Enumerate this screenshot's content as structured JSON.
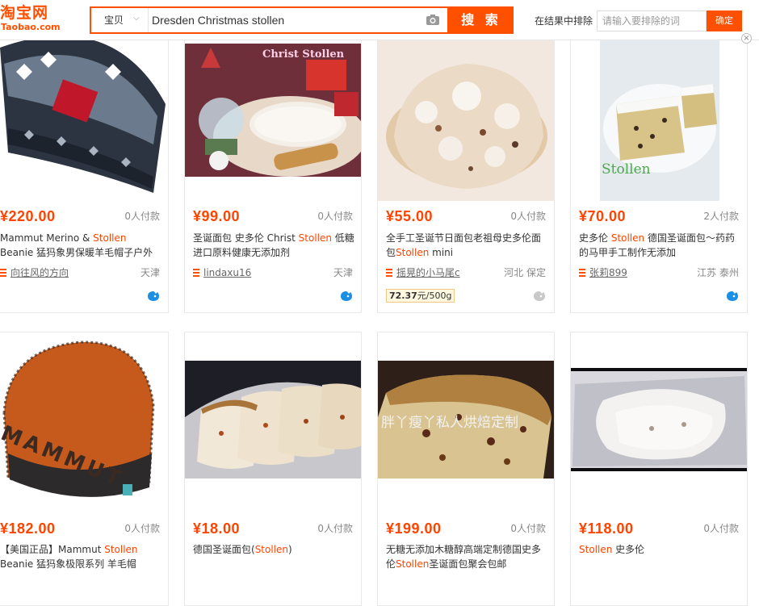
{
  "header": {
    "logo_cn": "淘宝网",
    "logo_en": "Taobao.com",
    "search_category": "宝贝",
    "search_query": "Dresden Christmas stollen",
    "search_button": "搜 索",
    "exclude_label": "在结果中排除",
    "exclude_placeholder": "请输入要排除的词",
    "exclude_button": "确定",
    "close_label": "×"
  },
  "row1": [
    {
      "price": "¥220.00",
      "sold": "0人付款",
      "title_pre": "Mammut Merino & ",
      "title_hl": "Stollen",
      "title_post": " Beanie 猛犸象男保暖羊毛帽子户外帽子",
      "shop": "向往风的方向",
      "location": "天津",
      "unit_price": null
    },
    {
      "price": "¥99.00",
      "sold": "0人付款",
      "title_pre": "圣诞面包 史多伦 Christ ",
      "title_hl": "Stollen",
      "title_post": " 低糖进口原料健康无添加剂",
      "shop": "lindaxu16",
      "location": "天津",
      "unit_price": null,
      "image_text": "Christ Stollen"
    },
    {
      "price": "¥55.00",
      "sold": "0人付款",
      "title_pre": "全手工圣诞节日面包老祖母史多伦面包",
      "title_hl": "Stollen",
      "title_post": " mini",
      "shop": "摇晃的小马尾c",
      "location": "河北 保定",
      "unit_price_value": "72.37",
      "unit_price_unit": "元/500g"
    },
    {
      "price": "¥70.00",
      "sold": "2人付款",
      "title_pre": "史多伦 ",
      "title_hl": "Stollen",
      "title_post": " 德国圣诞面包～药药的马甲手工制作无添加",
      "shop": "张莉899",
      "location": "江苏 泰州",
      "unit_price": null,
      "image_text": "Stollen"
    }
  ],
  "row2": [
    {
      "price": "¥182.00",
      "sold": "0人付款",
      "title_pre": "【美国正品】Mammut ",
      "title_hl": "Stollen",
      "title_post": " Beanie 猛犸象极限系列 羊毛帽",
      "image_text": "MAMMUT"
    },
    {
      "price": "¥18.00",
      "sold": "0人付款",
      "title_pre": "德国圣诞面包(",
      "title_hl": "Stollen",
      "title_post": ")"
    },
    {
      "price": "¥199.00",
      "sold": "0人付款",
      "title_pre": "无糖无添加木糖醇高端定制德国史多伦",
      "title_hl": "Stollen",
      "title_post": "圣诞面包聚会包邮",
      "image_text": "胖丫瘦丫私人烘焙定制"
    },
    {
      "price": "¥118.00",
      "sold": "0人付款",
      "title_pre": "",
      "title_hl": "Stollen",
      "title_post": " 史多伦"
    }
  ],
  "colors": {
    "brand": "#ff5000",
    "price": "#ff4400",
    "highlight": "#ff4400"
  }
}
